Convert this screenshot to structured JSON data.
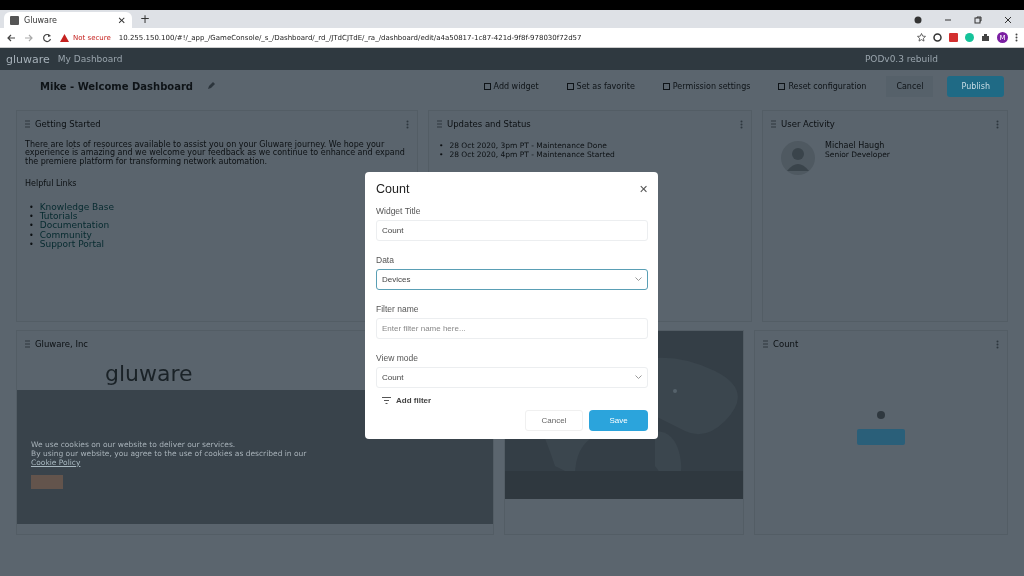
{
  "browser": {
    "tab_title": "Gluware",
    "close_tab": "✕",
    "new_tab": "+",
    "security": "Not secure",
    "url": "10.255.150.100/#!/_app_/GameConsole/_s_/Dashboard/_rd_/JTdCJTdE/_ra_/dashboard/edit/a4a50817-1c87-421d-9f8f-978030f72d57",
    "profile": "M"
  },
  "app_header": {
    "logo": "gluware",
    "breadcrumb": "My Dashboard",
    "device": "PODv0.3 rebuild"
  },
  "dashboard": {
    "title": "Mike - Welcome Dashboard",
    "actions": [
      "Add widget",
      "Set as favorite",
      "Permission settings",
      "Reset configuration"
    ],
    "cancel": "Cancel",
    "publish": "Publish"
  },
  "widgets": [
    {
      "kind": "text",
      "title": "Getting Started",
      "body": "There are lots of resources available to assist you on your Gluware journey. We hope your experience is amazing and we welcome your feedback as we continue to enhance and expand the premiere platform for transforming network automation.",
      "links_title": "Helpful Links",
      "bullet": "•",
      "links": [
        "Knowledge Base",
        "Tutorials",
        "Documentation",
        "Community",
        "Support Portal"
      ]
    },
    {
      "kind": "updates",
      "title": "Updates and Status",
      "bullet": "•",
      "items": [
        "28 Oct 2020, 3pm PT - Maintenance Done",
        "28 Oct 2020, 4pm PT - Maintenance Started"
      ]
    },
    {
      "kind": "user",
      "title": "User Activity",
      "name": "Michael Haugh",
      "role": "Senior Developer"
    },
    {
      "kind": "site",
      "title": "Gluware, Inc",
      "logo": "gluware",
      "cookie_lines": [
        "We use cookies on our website to deliver our services.",
        "By using our website, you agree to the use of cookies as described in our"
      ],
      "cookie_link": "Cookie Policy"
    },
    {
      "kind": "map"
    },
    {
      "kind": "count",
      "title": "Count"
    }
  ],
  "modal": {
    "title": "Count",
    "close": "✕",
    "fields": [
      {
        "kind": "input",
        "label": "Widget Title",
        "value": "Count",
        "focused": false
      },
      {
        "kind": "select",
        "label": "Data",
        "value": "Devices",
        "focused": true
      },
      {
        "kind": "input",
        "label": "Filter name",
        "placeholder": "Enter filter name here...",
        "focused": false
      },
      {
        "kind": "select",
        "label": "View mode",
        "value": "Count",
        "focused": false
      }
    ],
    "add_filter": "Add filter",
    "cancel": "Cancel",
    "save": "Save"
  }
}
